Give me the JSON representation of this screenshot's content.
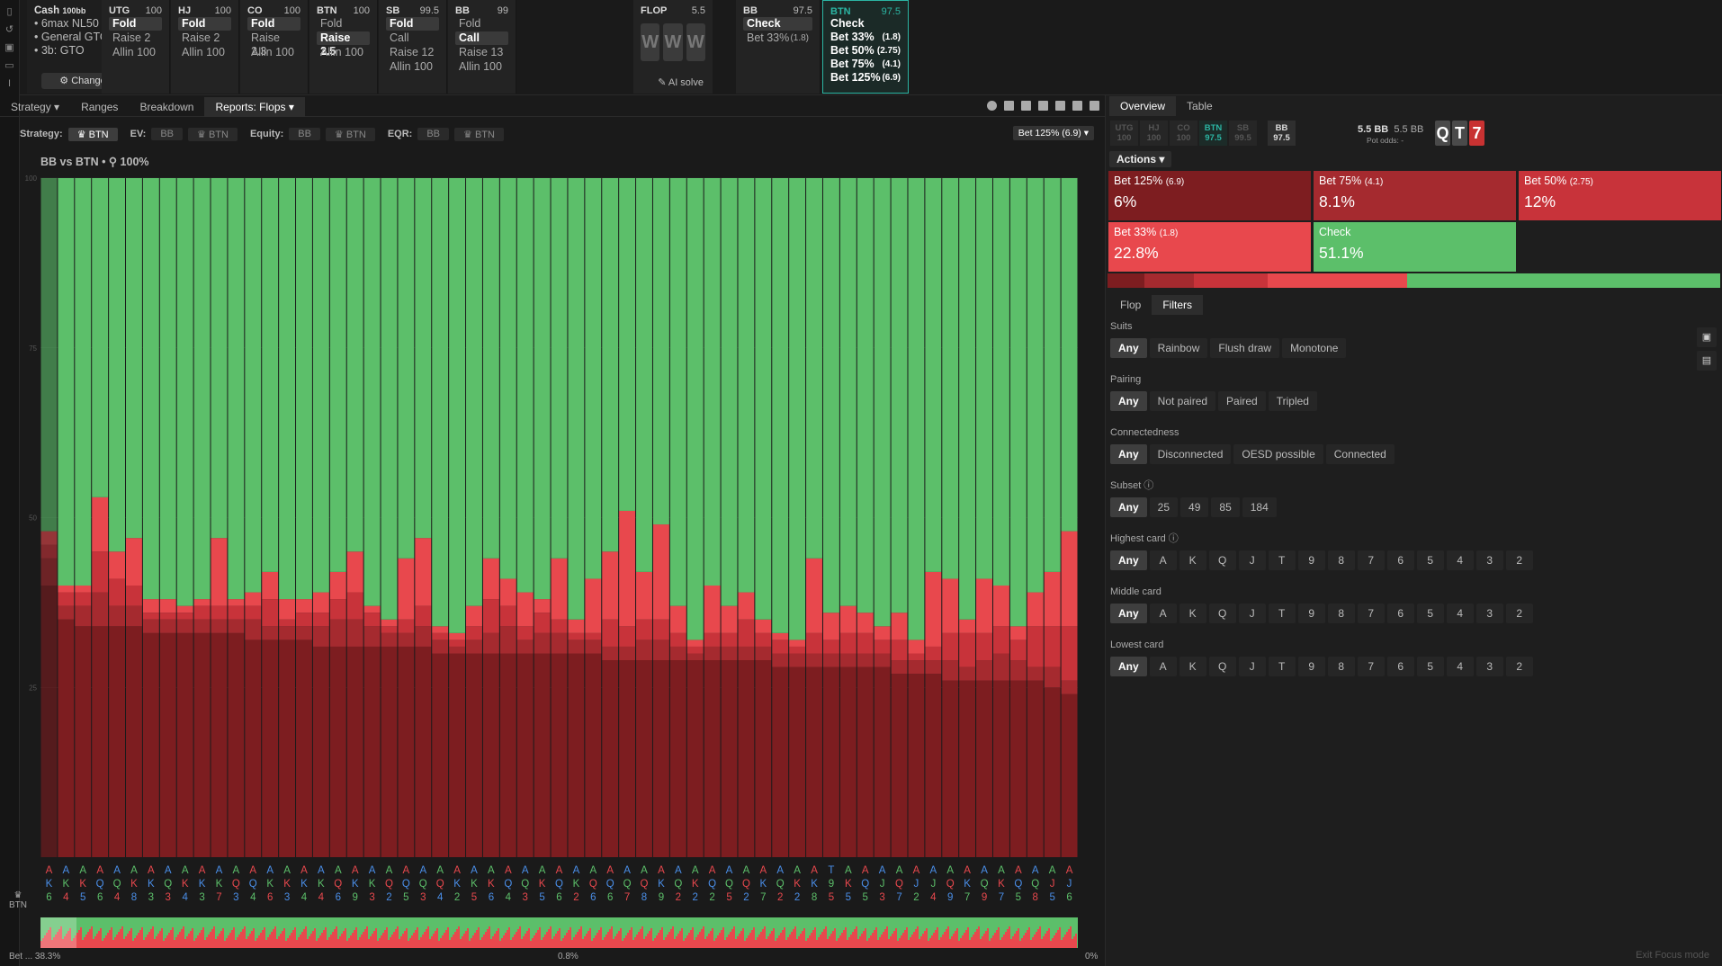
{
  "colors": {
    "check": "#5cbf6a",
    "bet33": "#e8484d",
    "bet50": "#c8333a",
    "bet75": "#a52a2f",
    "bet125": "#7d1d20",
    "accent": "#2bb5a3"
  },
  "left_rail": {
    "icons": [
      "bookmark-icon",
      "history-icon",
      "save-icon",
      "gamepad-icon",
      "text-cursor-icon"
    ]
  },
  "cash": {
    "title": "Cash",
    "title_suffix": "100bb",
    "lines": [
      "6max NL50",
      "General GTO",
      "3b: GTO"
    ],
    "change_label": "Change"
  },
  "positions": [
    {
      "name": "UTG",
      "stack": "100",
      "actions": [
        "Fold",
        "Raise 2",
        "Allin 100"
      ],
      "sel": 0
    },
    {
      "name": "HJ",
      "stack": "100",
      "actions": [
        "Fold",
        "Raise 2",
        "Allin 100"
      ],
      "sel": 0
    },
    {
      "name": "CO",
      "stack": "100",
      "actions": [
        "Fold",
        "Raise 2.3",
        "Allin 100"
      ],
      "sel": 0
    },
    {
      "name": "BTN",
      "stack": "100",
      "actions": [
        "Fold",
        "Raise 2.5",
        "Allin 100"
      ],
      "sel": 1
    },
    {
      "name": "SB",
      "stack": "99.5",
      "actions": [
        "Fold",
        "Call",
        "Raise 12",
        "Allin 100"
      ],
      "sel": 0
    },
    {
      "name": "BB",
      "stack": "99",
      "actions": [
        "Fold",
        "Call",
        "Raise 13",
        "Allin 100"
      ],
      "sel": 1
    }
  ],
  "flop": {
    "label": "FLOP",
    "pot": "5.5",
    "cards": [
      "W",
      "W",
      "W"
    ],
    "ai_solve": "AI solve"
  },
  "bb_card": {
    "name": "BB",
    "stack": "97.5",
    "actions": [
      "Check",
      "Bet 33%"
    ],
    "sizes": [
      "",
      "(1.8)"
    ]
  },
  "btn_card": {
    "name": "BTN",
    "stack": "97.5",
    "actions": [
      "Check",
      "Bet 33%",
      "Bet 50%",
      "Bet 75%",
      "Bet 125%"
    ],
    "sizes": [
      "",
      "(1.8)",
      "(2.75)",
      "(4.1)",
      "(6.9)"
    ]
  },
  "main_tabs": [
    "Strategy",
    "Ranges",
    "Breakdown",
    "Reports: Flops"
  ],
  "filterbar": {
    "strategy_label": "Strategy:",
    "strategy_val": "BTN",
    "ev_label": "EV:",
    "ev_opts": [
      "BB",
      "BTN"
    ],
    "equity_label": "Equity:",
    "equity_opts": [
      "BB",
      "BTN"
    ],
    "eqr_label": "EQR:",
    "eqr_opts": [
      "BB",
      "BTN"
    ],
    "bet_select": "Bet 125% (6.9)"
  },
  "chart_title": "BB vs BTN  •  ⚲ 100%",
  "chart_data": {
    "type": "bar",
    "stacked": true,
    "series_order": [
      "Bet 125%",
      "Bet 75%",
      "Bet 50%",
      "Bet 33%",
      "Check"
    ],
    "ylim": [
      0,
      100
    ],
    "yticks": [
      25,
      50,
      75,
      100
    ],
    "flops": [
      [
        "A",
        "K",
        "6",
        40,
        4,
        2,
        2
      ],
      [
        "A",
        "K",
        "4",
        35,
        2,
        2,
        1
      ],
      [
        "A",
        "K",
        "5",
        34,
        3,
        2,
        1
      ],
      [
        "A",
        "Q",
        "6",
        34,
        5,
        6,
        8
      ],
      [
        "A",
        "Q",
        "4",
        34,
        3,
        4,
        4
      ],
      [
        "A",
        "K",
        "8",
        34,
        3,
        3,
        7
      ],
      [
        "A",
        "K",
        "3",
        33,
        2,
        1,
        2
      ],
      [
        "A",
        "Q",
        "3",
        33,
        2,
        1,
        2
      ],
      [
        "A",
        "K",
        "4",
        33,
        2,
        1,
        1
      ],
      [
        "A",
        "K",
        "3",
        33,
        2,
        2,
        1
      ],
      [
        "A",
        "K",
        "7",
        33,
        2,
        2,
        10
      ],
      [
        "A",
        "Q",
        "3",
        33,
        2,
        2,
        1
      ],
      [
        "A",
        "Q",
        "4",
        32,
        3,
        2,
        2
      ],
      [
        "A",
        "K",
        "6",
        32,
        2,
        4,
        4
      ],
      [
        "A",
        "K",
        "3",
        32,
        2,
        1,
        3
      ],
      [
        "A",
        "K",
        "4",
        32,
        2,
        2,
        2
      ],
      [
        "A",
        "K",
        "4",
        31,
        3,
        2,
        3
      ],
      [
        "A",
        "Q",
        "6",
        31,
        4,
        3,
        4
      ],
      [
        "A",
        "K",
        "9",
        31,
        4,
        4,
        6
      ],
      [
        "A",
        "K",
        "3",
        31,
        3,
        2,
        1
      ],
      [
        "A",
        "Q",
        "2",
        31,
        2,
        1,
        1
      ],
      [
        "A",
        "Q",
        "5",
        31,
        2,
        2,
        9
      ],
      [
        "A",
        "Q",
        "3",
        31,
        3,
        3,
        10
      ],
      [
        "A",
        "Q",
        "4",
        30,
        2,
        1,
        1
      ],
      [
        "A",
        "K",
        "2",
        30,
        1,
        1,
        1
      ],
      [
        "A",
        "K",
        "5",
        30,
        2,
        2,
        3
      ],
      [
        "A",
        "K",
        "6",
        30,
        3,
        5,
        6
      ],
      [
        "A",
        "Q",
        "4",
        30,
        4,
        3,
        4
      ],
      [
        "A",
        "Q",
        "3",
        30,
        2,
        2,
        5
      ],
      [
        "A",
        "K",
        "5",
        30,
        3,
        3,
        2
      ],
      [
        "A",
        "Q",
        "6",
        30,
        3,
        2,
        9
      ],
      [
        "A",
        "K",
        "2",
        30,
        2,
        1,
        2
      ],
      [
        "A",
        "Q",
        "6",
        30,
        2,
        1,
        8
      ],
      [
        "A",
        "Q",
        "6",
        29,
        2,
        4,
        10
      ],
      [
        "A",
        "Q",
        "7",
        29,
        2,
        3,
        17
      ],
      [
        "A",
        "Q",
        "8",
        29,
        3,
        3,
        7
      ],
      [
        "A",
        "K",
        "9",
        29,
        3,
        3,
        14
      ],
      [
        "A",
        "Q",
        "2",
        29,
        2,
        2,
        4
      ],
      [
        "A",
        "K",
        "2",
        29,
        1,
        1,
        1
      ],
      [
        "A",
        "Q",
        "2",
        29,
        2,
        2,
        7
      ],
      [
        "A",
        "Q",
        "5",
        29,
        2,
        2,
        4
      ],
      [
        "A",
        "Q",
        "2",
        29,
        2,
        4,
        4
      ],
      [
        "A",
        "K",
        "7",
        29,
        2,
        2,
        2
      ],
      [
        "A",
        "Q",
        "2",
        28,
        2,
        2,
        1
      ],
      [
        "A",
        "K",
        "2",
        28,
        2,
        1,
        1
      ],
      [
        "A",
        "K",
        "8",
        28,
        2,
        3,
        11
      ],
      [
        "T",
        "9",
        "5",
        28,
        2,
        2,
        4
      ],
      [
        "A",
        "K",
        "5",
        28,
        2,
        3,
        4
      ],
      [
        "A",
        "Q",
        "5",
        28,
        2,
        3,
        3
      ],
      [
        "A",
        "J",
        "3",
        28,
        2,
        2,
        2
      ],
      [
        "A",
        "Q",
        "7",
        27,
        2,
        3,
        4
      ],
      [
        "A",
        "J",
        "2",
        27,
        2,
        1,
        2
      ],
      [
        "A",
        "J",
        "4",
        27,
        2,
        2,
        11
      ],
      [
        "A",
        "Q",
        "9",
        26,
        3,
        4,
        8
      ],
      [
        "A",
        "K",
        "7",
        26,
        2,
        5,
        2
      ],
      [
        "A",
        "Q",
        "9",
        26,
        3,
        4,
        8
      ],
      [
        "A",
        "K",
        "7",
        26,
        4,
        4,
        6
      ],
      [
        "A",
        "Q",
        "5",
        26,
        3,
        3,
        2
      ],
      [
        "A",
        "Q",
        "8",
        26,
        2,
        6,
        5
      ],
      [
        "A",
        "J",
        "5",
        25,
        3,
        6,
        8
      ],
      [
        "A",
        "J",
        "6",
        24,
        2,
        8,
        14
      ]
    ]
  },
  "bottom_status": {
    "left": "Bet ... 38.3%",
    "mid": "0.8%",
    "right": "0%"
  },
  "btn_label": "BTN",
  "right": {
    "tabs": [
      "Overview",
      "Table"
    ],
    "stacks": [
      {
        "pos": "UTG",
        "v": "100"
      },
      {
        "pos": "HJ",
        "v": "100"
      },
      {
        "pos": "CO",
        "v": "100"
      },
      {
        "pos": "BTN",
        "v": "97.5"
      },
      {
        "pos": "SB",
        "v": "99.5"
      },
      {
        "pos": "BB",
        "v": "97.5"
      }
    ],
    "pot": "5.5 BB",
    "pot2": "5.5 BB",
    "pot_odds": "Pot odds: -",
    "board": [
      {
        "r": "Q",
        "c": "#4a4a4a"
      },
      {
        "r": "T",
        "c": "#4a4a4a"
      },
      {
        "r": "7",
        "c": "#c83232"
      }
    ],
    "actions_label": "Actions",
    "actions": [
      {
        "label": "Bet 125%",
        "size": "(6.9)",
        "pct": "6%",
        "color": "#7d1d20"
      },
      {
        "label": "Bet 75%",
        "size": "(4.1)",
        "pct": "8.1%",
        "color": "#a52a2f"
      },
      {
        "label": "Bet 50%",
        "size": "(2.75)",
        "pct": "12%",
        "color": "#c8333a"
      },
      {
        "label": "Bet 33%",
        "size": "(1.8)",
        "pct": "22.8%",
        "color": "#e8484d"
      },
      {
        "label": "Check",
        "size": "",
        "pct": "51.1%",
        "color": "#5cbf6a"
      }
    ],
    "freq": [
      6,
      8.1,
      12,
      22.8,
      51.1
    ],
    "sub_tabs": [
      "Flop",
      "Filters"
    ],
    "filters": [
      {
        "title": "Suits",
        "opts": [
          "Any",
          "Rainbow",
          "Flush draw",
          "Monotone"
        ]
      },
      {
        "title": "Pairing",
        "opts": [
          "Any",
          "Not paired",
          "Paired",
          "Tripled"
        ]
      },
      {
        "title": "Connectedness",
        "opts": [
          "Any",
          "Disconnected",
          "OESD possible",
          "Connected"
        ]
      },
      {
        "title": "Subset ⓘ",
        "opts": [
          "Any",
          "25",
          "49",
          "85",
          "184"
        ]
      },
      {
        "title": "Highest card ⓘ",
        "opts": [
          "Any",
          "A",
          "K",
          "Q",
          "J",
          "T",
          "9",
          "8",
          "7",
          "6",
          "5",
          "4",
          "3",
          "2"
        ]
      },
      {
        "title": "Middle card",
        "opts": [
          "Any",
          "A",
          "K",
          "Q",
          "J",
          "T",
          "9",
          "8",
          "7",
          "6",
          "5",
          "4",
          "3",
          "2"
        ]
      },
      {
        "title": "Lowest card",
        "opts": [
          "Any",
          "A",
          "K",
          "Q",
          "J",
          "T",
          "9",
          "8",
          "7",
          "6",
          "5",
          "4",
          "3",
          "2"
        ]
      }
    ],
    "exit_focus": "Exit Focus mode"
  }
}
